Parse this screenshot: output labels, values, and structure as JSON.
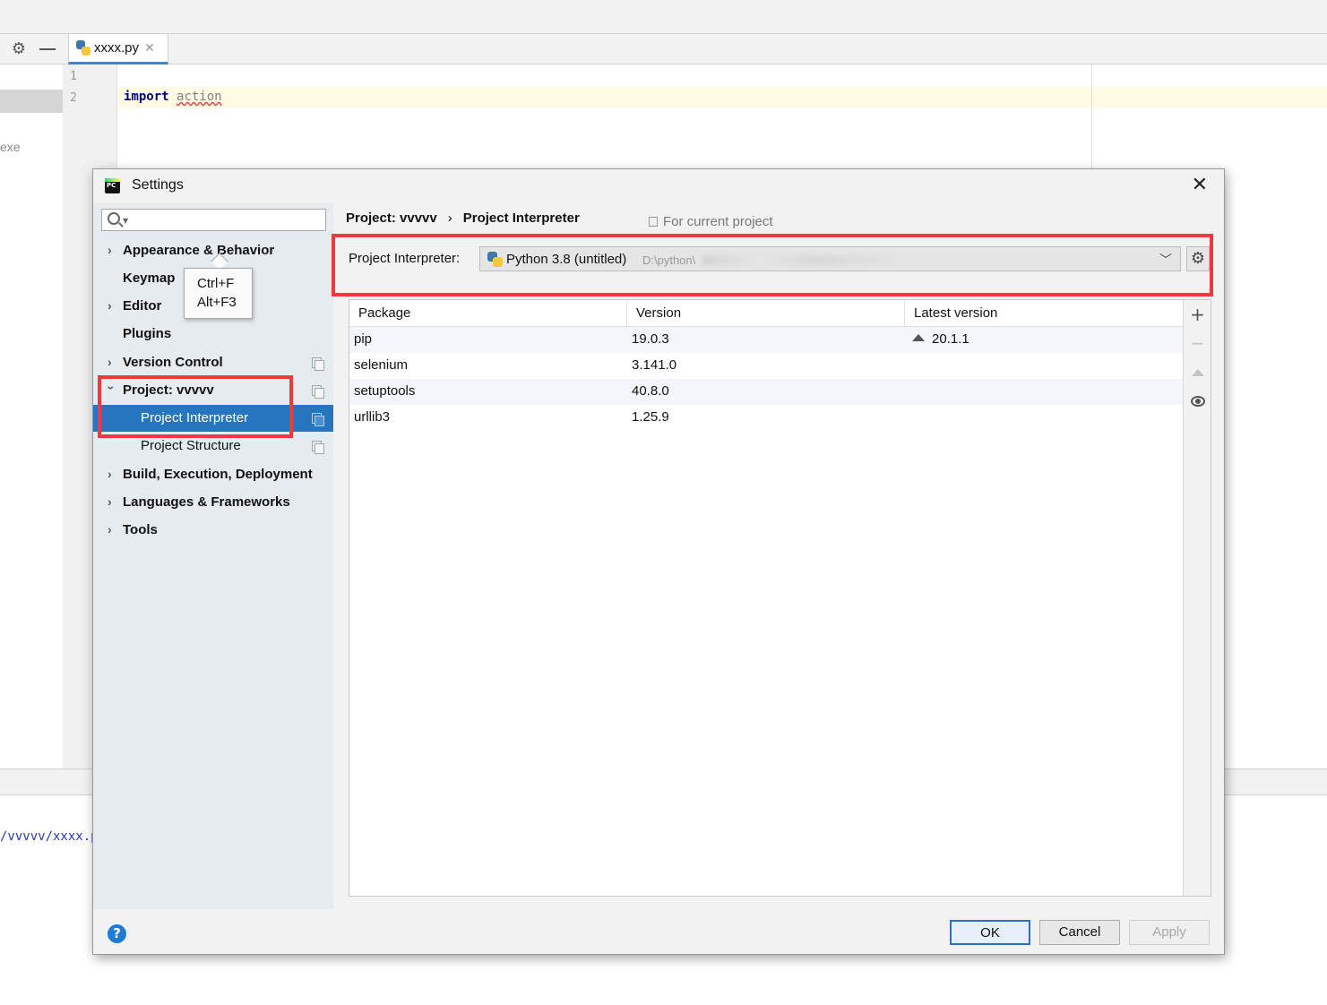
{
  "ide": {
    "file_tab": "xxxx.py",
    "line_numbers": [
      "1",
      "2"
    ],
    "code_keyword": "import",
    "code_module": "action",
    "left_fragment": "exe",
    "console_path": "/vvvvv/xxxx.p"
  },
  "dialog": {
    "title": "Settings",
    "search_placeholder": "",
    "tooltip": [
      "Ctrl+F",
      "Alt+F3"
    ],
    "tree": [
      {
        "label": "Appearance & Behavior",
        "expandable": true,
        "copy_icon": false
      },
      {
        "label": "Keymap",
        "expandable": false,
        "copy_icon": false
      },
      {
        "label": "Editor",
        "expandable": true,
        "copy_icon": false
      },
      {
        "label": "Plugins",
        "expandable": false,
        "copy_icon": false
      },
      {
        "label": "Version Control",
        "expandable": true,
        "copy_icon": true
      },
      {
        "label": "Project: vvvvv",
        "expandable": true,
        "expanded": true,
        "copy_icon": true
      },
      {
        "label": "Project Interpreter",
        "selected": true,
        "copy_icon": true
      },
      {
        "label": "Project Structure",
        "copy_icon": true
      },
      {
        "label": "Build, Execution, Deployment",
        "expandable": true,
        "copy_icon": false
      },
      {
        "label": "Languages & Frameworks",
        "expandable": true,
        "copy_icon": false
      },
      {
        "label": "Tools",
        "expandable": true,
        "copy_icon": false
      }
    ],
    "breadcrumb": [
      "Project: vvvvv",
      "Project Interpreter"
    ],
    "for_current_project": "For current project",
    "interpreter_label": "Project Interpreter:",
    "interpreter_name": "Python 3.8 (untitled)",
    "interpreter_path": "D:\\python\\",
    "table": {
      "headers": [
        "Package",
        "Version",
        "Latest version"
      ],
      "rows": [
        {
          "package": "pip",
          "version": "19.0.3",
          "latest": "20.1.1"
        },
        {
          "package": "selenium",
          "version": "3.141.0",
          "latest": ""
        },
        {
          "package": "setuptools",
          "version": "40.8.0",
          "latest": ""
        },
        {
          "package": "urllib3",
          "version": "1.25.9",
          "latest": ""
        }
      ]
    },
    "buttons": {
      "ok": "OK",
      "cancel": "Cancel",
      "apply": "Apply",
      "help": "?"
    },
    "highlight_color": "#f0383e",
    "selection_color": "#2675bf"
  }
}
